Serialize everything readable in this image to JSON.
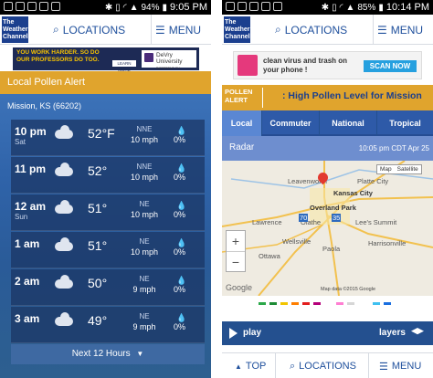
{
  "screen1": {
    "status": {
      "icons": [
        "notification",
        "image",
        "image",
        "image",
        "image",
        "bluetooth",
        "vibrate",
        "wifi",
        "signal",
        "battery"
      ],
      "battery": "94%",
      "time": "9:05 PM"
    },
    "header": {
      "logo": "The Weather Channel",
      "locations_label": "LOCATIONS",
      "menu_label": "MENU"
    },
    "ad": {
      "text": "YOU WORK HARDER. SO DO OUR PROFESSORS DO TOO.",
      "button": "LEARN MORE",
      "brand": "DeVry University",
      "brand_tag": "DIFFERENT ON PURPOSE."
    },
    "pollen_banner": "Local Pollen Alert",
    "location": "Mission, KS (66202)",
    "hours": [
      {
        "time": "10 pm",
        "day": "Sat",
        "temp": "52°F",
        "wind_dir": "NNE",
        "wind_speed": "10 mph",
        "precip": "0%"
      },
      {
        "time": "11 pm",
        "day": "",
        "temp": "52°",
        "wind_dir": "NNE",
        "wind_speed": "10 mph",
        "precip": "0%"
      },
      {
        "time": "12 am",
        "day": "Sun",
        "temp": "51°",
        "wind_dir": "NE",
        "wind_speed": "10 mph",
        "precip": "0%"
      },
      {
        "time": "1 am",
        "day": "",
        "temp": "51°",
        "wind_dir": "NE",
        "wind_speed": "10 mph",
        "precip": "0%"
      },
      {
        "time": "2 am",
        "day": "",
        "temp": "50°",
        "wind_dir": "NE",
        "wind_speed": "9 mph",
        "precip": "0%"
      },
      {
        "time": "3 am",
        "day": "",
        "temp": "49°",
        "wind_dir": "NE",
        "wind_speed": "9 mph",
        "precip": "0%"
      }
    ],
    "next_label": "Next 12 Hours"
  },
  "screen2": {
    "status": {
      "icons": [
        "notification",
        "image",
        "image",
        "image",
        "image",
        "bluetooth",
        "vibrate",
        "wifi",
        "signal",
        "battery"
      ],
      "battery": "85%",
      "time": "10:14 PM"
    },
    "header": {
      "logo": "The Weather Channel",
      "locations_label": "LOCATIONS",
      "menu_label": "MENU"
    },
    "ad": {
      "text": "clean virus and trash on your phone !",
      "button": "SCAN NOW"
    },
    "pollen_banner": {
      "label": "POLLEN ALERT",
      "text": ": High Pollen Level for Mission"
    },
    "tabs": [
      "Local",
      "Commuter",
      "National",
      "Tropical"
    ],
    "radar": {
      "label": "Radar",
      "timestamp": "10:05 pm CDT Apr 25"
    },
    "map": {
      "toggle": [
        "Map",
        "Satellite"
      ],
      "labels": [
        "Leavenworth",
        "Platte City",
        "Kansas City",
        "Overland Park",
        "Lawrence",
        "Olathe",
        "Lee's Summit",
        "Ottawa",
        "Paola",
        "Harrisonville",
        "Wellsville"
      ],
      "roads": [
        "35",
        "70"
      ],
      "attribution": "Map data ©2015 Google",
      "watermark": "Google"
    },
    "legend_colors": [
      "#2ca84a",
      "#1e8c36",
      "#f2c500",
      "#ff7f00",
      "#e31e1e",
      "#b5007a",
      "#ff7fd2",
      "#d6d6d6",
      "#3fc0f0",
      "#1a6fe0"
    ],
    "play_label": "play",
    "layers_label": "layers",
    "bottom_nav": {
      "top": "TOP",
      "locations": "LOCATIONS",
      "menu": "MENU"
    }
  }
}
